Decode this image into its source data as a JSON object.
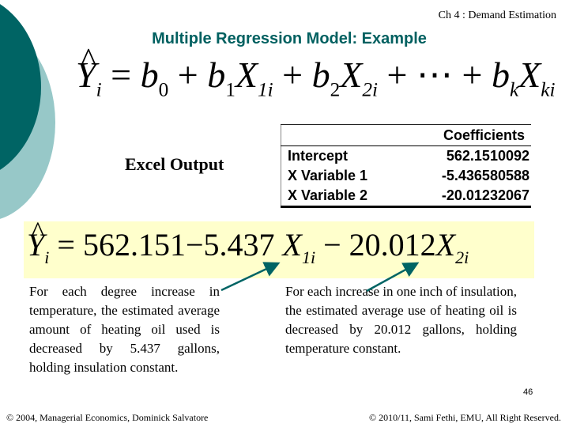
{
  "header": {
    "chapter": "Ch 4 : Demand Estimation"
  },
  "title": "Multiple Regression Model: Example",
  "general_equation": {
    "lhs_var": "Y",
    "lhs_sub": "i",
    "equals": "=",
    "b0": "b",
    "b0_sub": "0",
    "b1": "b",
    "b1_sub": "1",
    "x1": "X",
    "x1_sub": "1i",
    "b2": "b",
    "b2_sub": "2",
    "x2": "X",
    "x2_sub": "2i",
    "ellipsis": "+ ⋯ +",
    "bk": "b",
    "bk_sub": "k",
    "xk": "X",
    "xk_sub": "ki",
    "plus": "+"
  },
  "excel_label": "Excel Output",
  "coefficients_table": {
    "header": [
      "",
      "Coefficients"
    ],
    "rows": [
      {
        "label": "Intercept",
        "value": "562.1510092"
      },
      {
        "label": "X Variable 1",
        "value": "-5.436580588"
      },
      {
        "label": "X Variable 2",
        "value": "-20.01232067"
      }
    ]
  },
  "fitted_equation": {
    "lhs_var": "Y",
    "lhs_sub": "i",
    "equals": "=",
    "intercept": "562.151",
    "minus": "−",
    "coef1": "5.437",
    "x1": "X",
    "x1_sub": "1i",
    "coef2": "20.012",
    "x2": "X",
    "x2_sub": "2i"
  },
  "interpretation_left": "For each degree increase in temperature, the estimated average amount of heating oil used is decreased by 5.437 gallons, holding insulation constant.",
  "interpretation_right": "For each increase in one inch of insulation, the estimated average use of heating oil is decreased by 20.012 gallons, holding temperature constant.",
  "page_number": "46",
  "footer": {
    "left": "© 2004,  Managerial Economics, Dominick Salvatore",
    "right": "© 2010/11, Sami Fethi, EMU, All Right Reserved."
  },
  "colors": {
    "title": "#006060",
    "dark_teal": "#006464",
    "light_teal": "#97c8c8",
    "highlight": "#ffffcc",
    "arrow": "#006464"
  }
}
